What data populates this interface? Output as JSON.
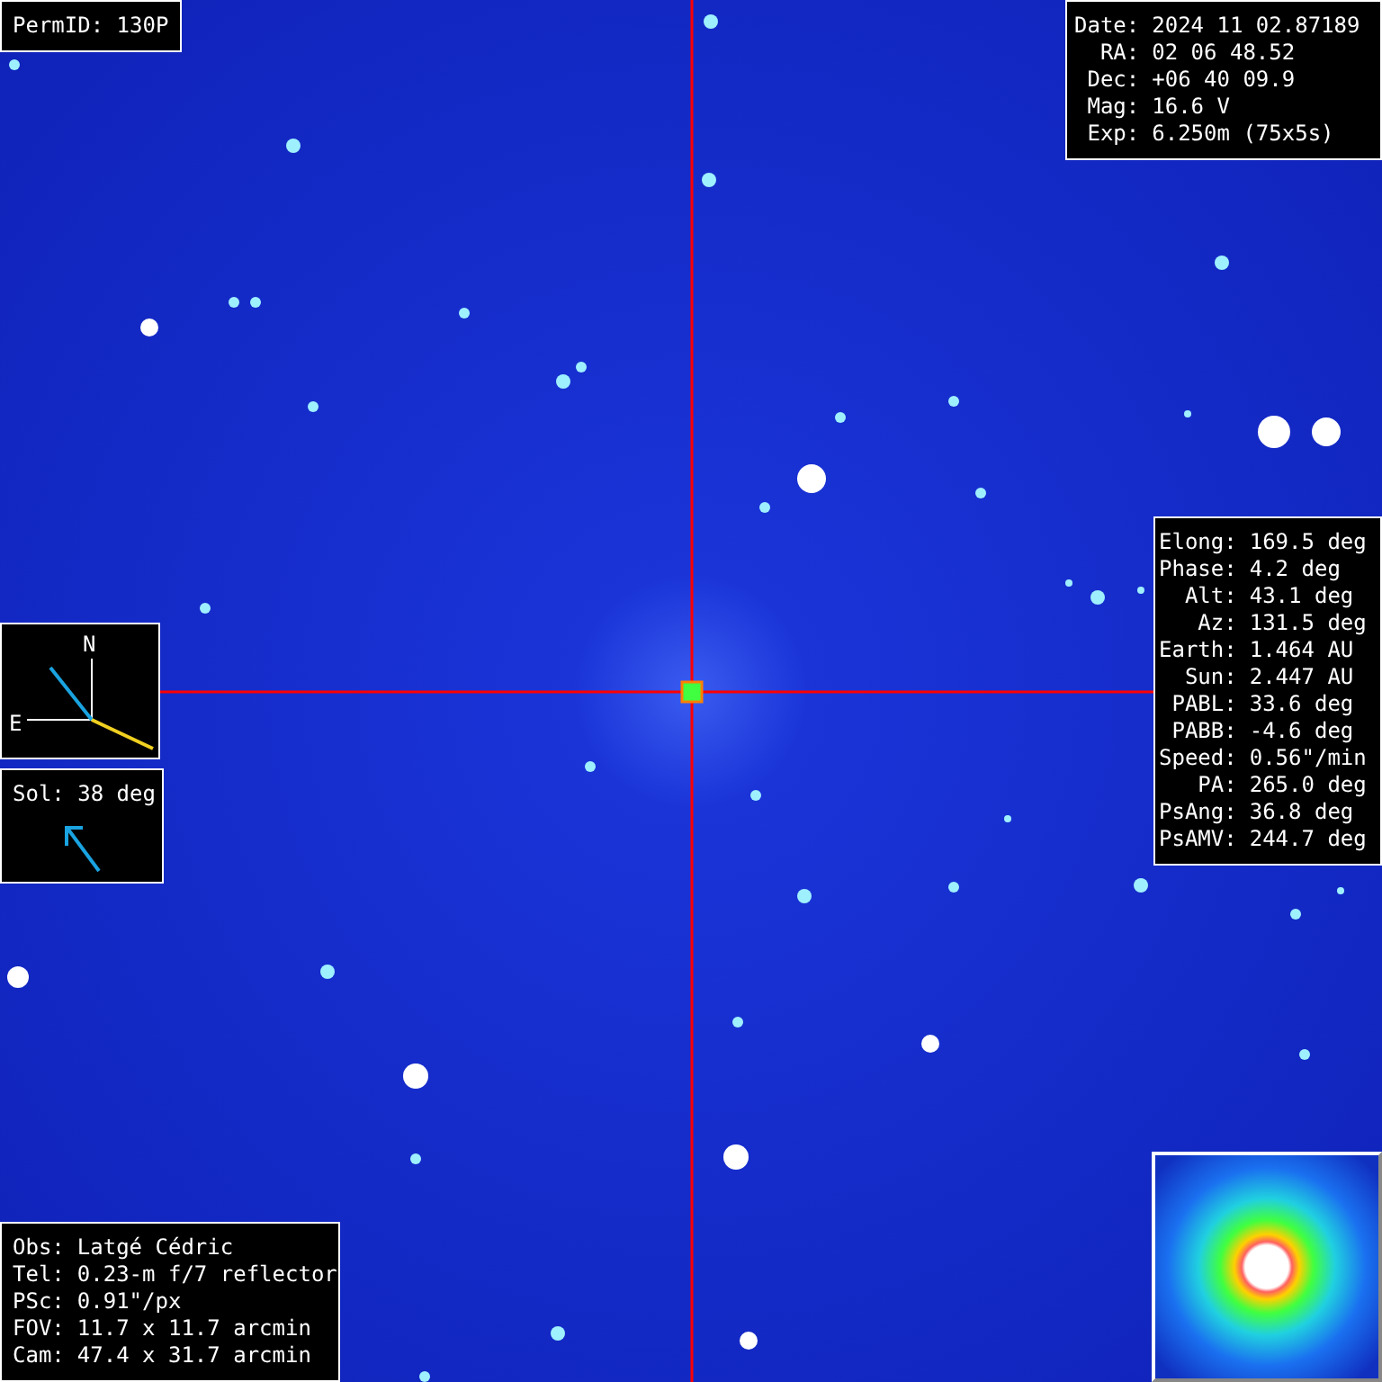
{
  "perm_id": {
    "label": "PermID:",
    "value": "130P"
  },
  "observation": [
    {
      "label": "Date:",
      "value": "2024 11 02.87189"
    },
    {
      "label": "RA:",
      "value": "02 06 48.52"
    },
    {
      "label": "Dec:",
      "value": "+06 40 09.9"
    },
    {
      "label": "Mag:",
      "value": "16.6 V"
    },
    {
      "label": "Exp:",
      "value": "6.250m (75x5s)"
    }
  ],
  "geometry": [
    {
      "label": "Elong:",
      "value": "169.5 deg"
    },
    {
      "label": "Phase:",
      "value": "4.2 deg"
    },
    {
      "label": "Alt:",
      "value": "43.1 deg"
    },
    {
      "label": "Az:",
      "value": "131.5 deg"
    },
    {
      "label": "Earth:",
      "value": "1.464 AU"
    },
    {
      "label": "Sun:",
      "value": "2.447 AU"
    },
    {
      "label": "PABL:",
      "value": "33.6 deg"
    },
    {
      "label": "PABB:",
      "value": "-4.6 deg"
    },
    {
      "label": "Speed:",
      "value": "0.56\"/min"
    },
    {
      "label": "PA:",
      "value": "265.0 deg"
    },
    {
      "label": "PsAng:",
      "value": "36.8 deg"
    },
    {
      "label": "PsAMV:",
      "value": "244.7 deg"
    }
  ],
  "compass": {
    "north": "N",
    "east": "E"
  },
  "sol": {
    "label": "Sol:",
    "value": "38 deg"
  },
  "instrument": [
    {
      "label": "Obs:",
      "value": "Latgé Cédric"
    },
    {
      "label": "Tel:",
      "value": "0.23-m f/7 reflector"
    },
    {
      "label": "PSc:",
      "value": "0.91\"/px"
    },
    {
      "label": "FOV:",
      "value": "11.7 x 11.7 arcmin"
    },
    {
      "label": "Cam:",
      "value": "47.4 x 31.7 arcmin"
    }
  ]
}
